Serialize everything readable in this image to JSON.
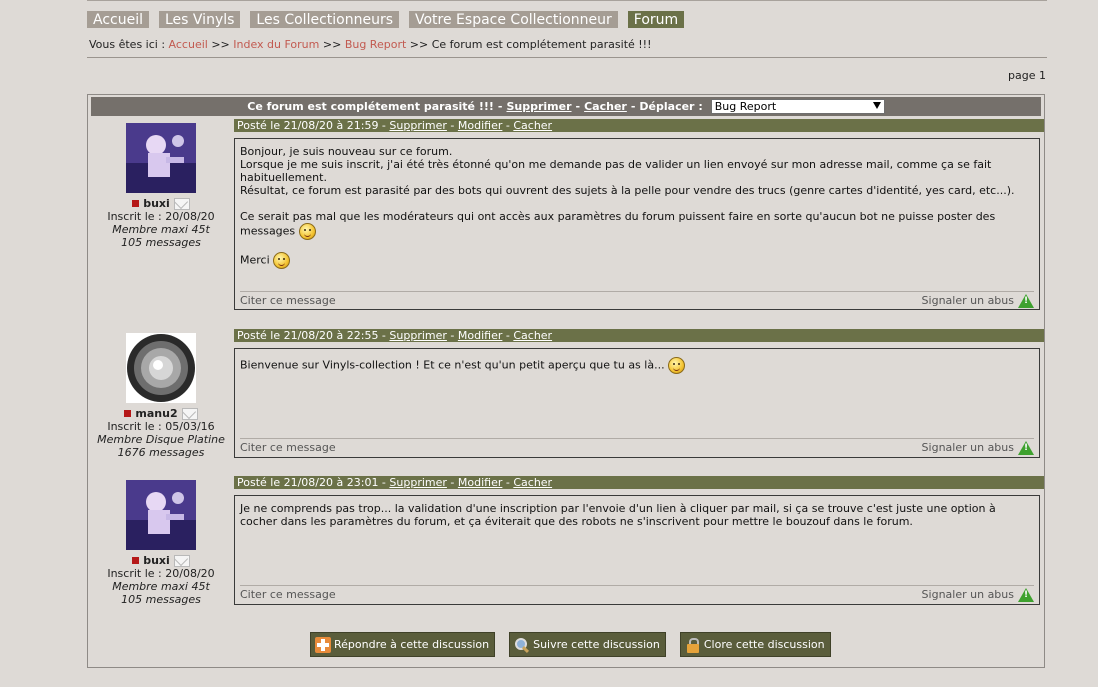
{
  "nav": [
    {
      "label": "Accueil",
      "active": false
    },
    {
      "label": "Les Vinyls",
      "active": false
    },
    {
      "label": "Les Collectionneurs",
      "active": false
    },
    {
      "label": "Votre Espace Collectionneur",
      "active": false
    },
    {
      "label": "Forum",
      "active": true
    }
  ],
  "breadcrumb": {
    "prefix": "Vous êtes ici : ",
    "home": "Accueil",
    "sep": " >> ",
    "index": "Index du Forum",
    "category": "Bug Report",
    "current": "Ce forum est complétement parasité !!!"
  },
  "page_indicator": "page 1",
  "topic": {
    "title": "Ce forum est complétement parasité !!!",
    "dash": " - ",
    "delete": "Supprimer",
    "hide": "Cacher",
    "move_label": "Déplacer :",
    "move_selected": "Bug Report"
  },
  "posts": [
    {
      "user": {
        "name": "buxi",
        "registered": "Inscrit le : 20/08/20",
        "rank": "Membre maxi 45t",
        "messages": "105 messages"
      },
      "posted": "Posté le 21/08/20 à 21:59",
      "delete": "Supprimer",
      "edit": "Modifier",
      "hide": "Cacher",
      "body": [
        "Bonjour, je suis nouveau sur ce forum.",
        "Lorsque je me suis inscrit, j'ai été très étonné qu'on me demande pas de valider un lien envoyé sur mon adresse mail, comme ça se fait habituellement.",
        "Résultat, ce forum est parasité par des bots qui ouvrent des sujets à la pelle pour vendre des trucs (genre cartes d'identité, yes card, etc...).",
        "Ce serait pas mal que les modérateurs qui ont accès aux paramètres du forum puissent faire en sorte qu'aucun bot ne puisse poster des messages",
        "Merci"
      ],
      "cite": "Citer ce message",
      "report": "Signaler un abus"
    },
    {
      "user": {
        "name": "manu2",
        "registered": "Inscrit le : 05/03/16",
        "rank": "Membre Disque Platine",
        "messages": "1676 messages"
      },
      "posted": "Posté le 21/08/20 à 22:55",
      "delete": "Supprimer",
      "edit": "Modifier",
      "hide": "Cacher",
      "body": [
        "Bienvenue sur Vinyls-collection ! Et ce n'est qu'un petit aperçu que tu as là..."
      ],
      "cite": "Citer ce message",
      "report": "Signaler un abus"
    },
    {
      "user": {
        "name": "buxi",
        "registered": "Inscrit le : 20/08/20",
        "rank": "Membre maxi 45t",
        "messages": "105 messages"
      },
      "posted": "Posté le 21/08/20 à 23:01",
      "delete": "Supprimer",
      "edit": "Modifier",
      "hide": "Cacher",
      "body": [
        "Je ne comprends pas trop... la validation d'une inscription par l'envoie d'un lien à cliquer par mail, si ça se trouve c'est juste une option à cocher dans les paramètres du forum, et ça éviterait que des robots ne s'inscrivent pour mettre le bouzouf dans le forum."
      ],
      "cite": "Citer ce message",
      "report": "Signaler un abus"
    }
  ],
  "actions": {
    "reply": "Répondre à cette discussion",
    "follow": "Suivre cette discussion",
    "close": "Clore cette discussion"
  },
  "icons": {
    "reply": "plus-icon",
    "follow": "magnifier-icon",
    "close": "lock-icon",
    "report": "warning-icon",
    "mail": "mail-icon"
  },
  "colors": {
    "nav_bg": "#a59d94",
    "nav_active": "#6b7148",
    "post_header": "#6b7148",
    "topic_header": "#75706b",
    "link": "#c25a50",
    "background": "#dedad6"
  }
}
